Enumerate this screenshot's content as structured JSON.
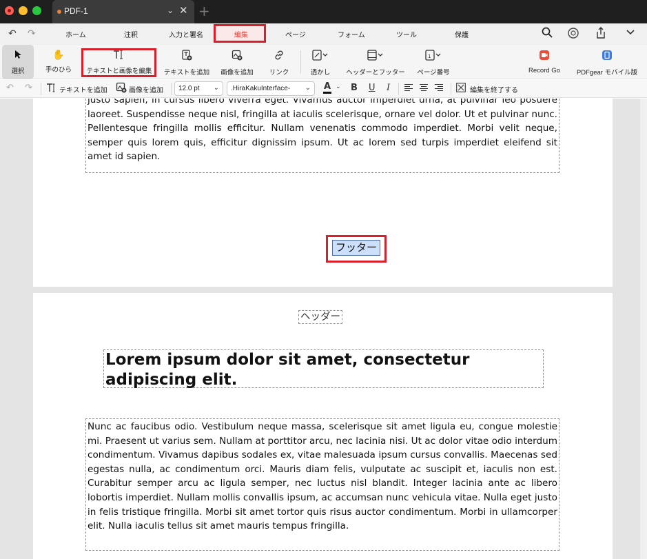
{
  "window": {
    "tab_title": "PDF-1",
    "tab_chevron": "⌄",
    "tab_close": "✕",
    "new_tab": "+"
  },
  "menu": {
    "items": [
      "ホーム",
      "注釈",
      "入力と署名",
      "編集",
      "ページ",
      "フォーム",
      "ツール",
      "保護"
    ],
    "active": "編集"
  },
  "tools": {
    "select": "選択",
    "hand": "手のひら",
    "edit_text_image": "テキストと画像を編集",
    "add_text": "テキストを追加",
    "add_image": "画像を追加",
    "link": "リンク",
    "watermark": "透かし",
    "header_footer": "ヘッダーとフッター",
    "page_number": "ページ番号",
    "record_go": "Record Go",
    "pdfgear_mobile": "PDFgear モバイル版"
  },
  "format": {
    "add_text": "テキストを追加",
    "add_image": "画像を追加",
    "font_size": "12.0 pt",
    "font_family": ".HiraKakuInterface-",
    "finish_editing": "編集を終了する",
    "bold": "B",
    "underline": "U",
    "italic": "I",
    "font_color_letter": "A"
  },
  "colors": {
    "accent_red": "#d9202a",
    "active_menu": "#e0413a",
    "selection_fill": "#cde0fb"
  },
  "page1": {
    "body": "justo sapien, in cursus libero viverra eget. Vivamus auctor imperdiet urna, at pulvinar leo posuere laoreet. Suspendisse neque nisl, fringilla at iaculis scelerisque, ornare vel dolor. Ut et pulvinar nunc. Pellentesque fringilla mollis efficitur. Nullam venenatis commodo imperdiet. Morbi velit neque, semper quis lorem quis, efficitur dignissim ipsum. Ut ac lorem sed turpis imperdiet eleifend sit amet id sapien.",
    "footer": "フッター"
  },
  "page2": {
    "header": "ヘッダー",
    "title": "Lorem ipsum dolor sit amet, consectetur adipiscing elit.",
    "body": "Nunc ac faucibus odio. Vestibulum neque massa, scelerisque sit amet ligula eu, congue molestie mi. Praesent ut varius sem. Nullam at porttitor arcu, nec lacinia nisi. Ut ac dolor vitae odio interdum condimentum. Vivamus dapibus sodales ex, vitae malesuada ipsum cursus convallis. Maecenas sed egestas nulla, ac condimentum orci. Mauris diam felis, vulputate ac suscipit et, iaculis non est. Curabitur semper arcu ac ligula semper, nec luctus nisl blandit. Integer lacinia ante ac libero lobortis imperdiet. Nullam mollis convallis ipsum, ac accumsan nunc vehicula vitae. Nulla eget justo in felis tristique fringilla. Morbi sit amet tortor quis risus auctor condimentum. Morbi in ullamcorper elit. Nulla iaculis tellus sit amet mauris tempus fringilla."
  }
}
